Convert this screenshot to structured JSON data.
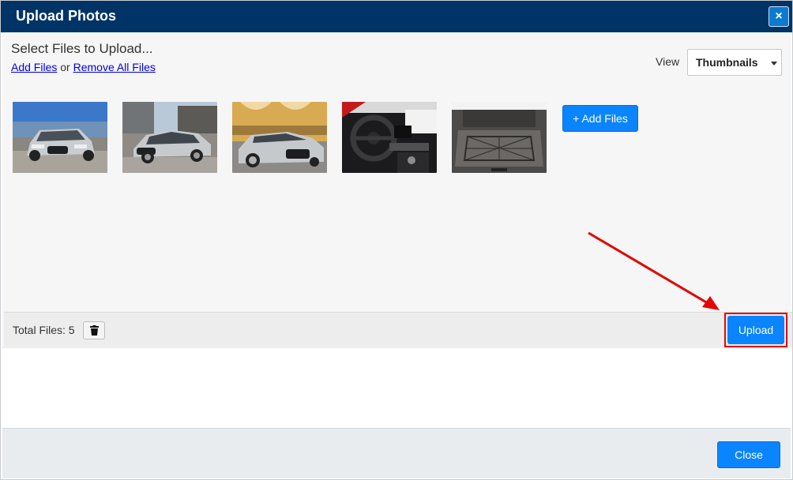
{
  "dialog": {
    "title": "Upload Photos",
    "close_x": "×"
  },
  "upload_area": {
    "heading": "Select Files to Upload...",
    "add_files_link": "Add Files",
    "or_text": "or",
    "remove_all_link": "Remove All Files",
    "view_label": "View",
    "view_selected": "Thumbnails",
    "add_files_button": "+ Add Files",
    "thumbnails": [
      {
        "name": "car-front-exterior-photo"
      },
      {
        "name": "car-side-exterior-photo"
      },
      {
        "name": "car-front-garage-photo"
      },
      {
        "name": "car-dashboard-interior-photo"
      },
      {
        "name": "car-trunk-cargo-photo"
      }
    ]
  },
  "footer": {
    "total_files_label": "Total Files: 5",
    "upload_button": "Upload",
    "trash_icon": "trash-icon"
  },
  "bottom": {
    "close_button": "Close"
  },
  "colors": {
    "title_bar": "#003366",
    "primary_button": "#0a84ff",
    "highlight": "#e10600"
  }
}
